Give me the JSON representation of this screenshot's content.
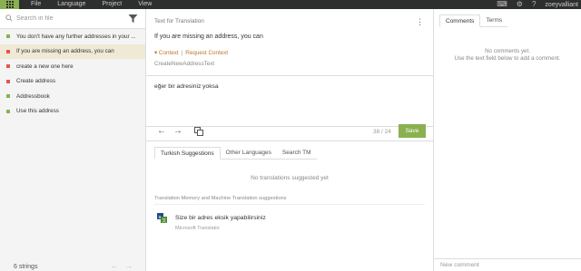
{
  "menubar": {
    "items": [
      "File",
      "Language",
      "Project",
      "View"
    ],
    "username": "zoeyvalliant",
    "accent": "#8ab14f",
    "background": "#2d2e2e"
  },
  "sidebar": {
    "search_placeholder": "Search in file",
    "strings": [
      {
        "text": "You don't have any further addresses in your ...",
        "status_color": "#8ab14f",
        "active": false
      },
      {
        "text": "If you are missing an address, you can",
        "status_color": "#e4554d",
        "active": true
      },
      {
        "text": "create a new one here",
        "status_color": "#e4554d",
        "active": false
      },
      {
        "text": "Create address",
        "status_color": "#e4554d",
        "active": false
      },
      {
        "text": "Addressbook",
        "status_color": "#8ab14f",
        "active": false
      },
      {
        "text": "Use this address",
        "status_color": "#8ab14f",
        "active": false
      }
    ],
    "footer_count": "6 strings"
  },
  "editor": {
    "source_label": "Text for Translation",
    "source_text": "If you are missing an address, you can",
    "context_label": "Context",
    "request_context_label": "Request Context",
    "key": "CreateNewAddressText",
    "translation": "eğer bir adresiniz yoksa",
    "char_count": "38 / 24",
    "save_label": "Save"
  },
  "suggestions": {
    "tabs": [
      "Turkish Suggestions",
      "Other Languages",
      "Search TM"
    ],
    "empty_text": "No translations suggested yet",
    "tm_heading": "Translation Memory and Machine Translation suggestions",
    "mt_text": "Size bir adres eksik yapabilirsiniz",
    "mt_source": "Microsoft Translator"
  },
  "comments": {
    "tabs": [
      "Comments",
      "Terms"
    ],
    "empty_line1": "No comments yet.",
    "empty_line2": "Use the text field below to add a comment.",
    "new_placeholder": "New comment"
  }
}
